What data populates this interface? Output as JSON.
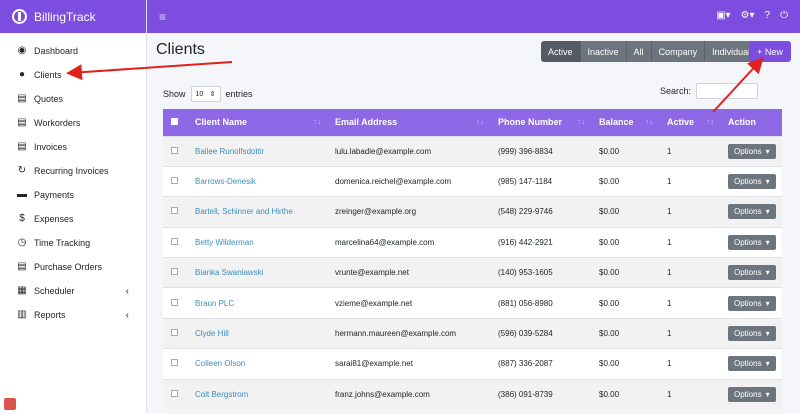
{
  "brand": {
    "name": "BillingTrack"
  },
  "topbar": {
    "menu_icon": "hamburger-icon",
    "icons": [
      "briefcase-icon",
      "gear-icon",
      "help-icon",
      "power-icon"
    ]
  },
  "sidebar": {
    "items": [
      {
        "label": "Dashboard",
        "icon": "dashboard-icon"
      },
      {
        "label": "Clients",
        "icon": "users-icon"
      },
      {
        "label": "Quotes",
        "icon": "file-icon"
      },
      {
        "label": "Workorders",
        "icon": "file-icon"
      },
      {
        "label": "Invoices",
        "icon": "file-icon"
      },
      {
        "label": "Recurring Invoices",
        "icon": "sync-icon"
      },
      {
        "label": "Payments",
        "icon": "credit-card-icon"
      },
      {
        "label": "Expenses",
        "icon": "dollar-icon"
      },
      {
        "label": "Time Tracking",
        "icon": "clock-icon"
      },
      {
        "label": "Purchase Orders",
        "icon": "file-icon"
      },
      {
        "label": "Scheduler",
        "icon": "calendar-icon"
      },
      {
        "label": "Reports",
        "icon": "chart-icon"
      }
    ]
  },
  "page": {
    "title": "Clients"
  },
  "filters": [
    "Active",
    "Inactive",
    "All",
    "Company",
    "Individual"
  ],
  "new_button": {
    "label": "+ New"
  },
  "table_controls": {
    "show": "Show",
    "entries_value": "10",
    "entries": "entries",
    "search_label": "Search:"
  },
  "table": {
    "columns": [
      "Client Name",
      "Email Address",
      "Phone Number",
      "Balance",
      "Active",
      "Action"
    ],
    "action_label": "Options",
    "rows": [
      {
        "name": "Bailee Runolfsdottir",
        "email": "lulu.labadie@example.com",
        "phone": "(999) 396-8834",
        "balance": "$0.00",
        "active": "1"
      },
      {
        "name": "Barrows-Denesik",
        "email": "domenica.reichel@example.com",
        "phone": "(985) 147-1184",
        "balance": "$0.00",
        "active": "1"
      },
      {
        "name": "Bartell, Schinner and Hirthe",
        "email": "zreinger@example.org",
        "phone": "(548) 229-9746",
        "balance": "$0.00",
        "active": "1"
      },
      {
        "name": "Betty Wilderman",
        "email": "marcelina64@example.com",
        "phone": "(916) 442-2921",
        "balance": "$0.00",
        "active": "1"
      },
      {
        "name": "Bianka Swaniawski",
        "email": "vrunte@example.net",
        "phone": "(140) 953-1605",
        "balance": "$0.00",
        "active": "1"
      },
      {
        "name": "Braun PLC",
        "email": "vzieme@example.net",
        "phone": "(881) 056-8980",
        "balance": "$0.00",
        "active": "1"
      },
      {
        "name": "Clyde Hill",
        "email": "hermann.maureen@example.com",
        "phone": "(596) 039-5284",
        "balance": "$0.00",
        "active": "1"
      },
      {
        "name": "Colleen Olson",
        "email": "sarai81@example.net",
        "phone": "(887) 336-2087",
        "balance": "$0.00",
        "active": "1"
      },
      {
        "name": "Colt Bergstrom",
        "email": "franz.johns@example.com",
        "phone": "(386) 091-8739",
        "balance": "$0.00",
        "active": "1"
      }
    ]
  },
  "colors": {
    "brand": "#7c4dde",
    "table_header": "#8e68e6",
    "link": "#3c8dbc",
    "button_gray": "#6c757d",
    "arrow": "#e3201b"
  }
}
